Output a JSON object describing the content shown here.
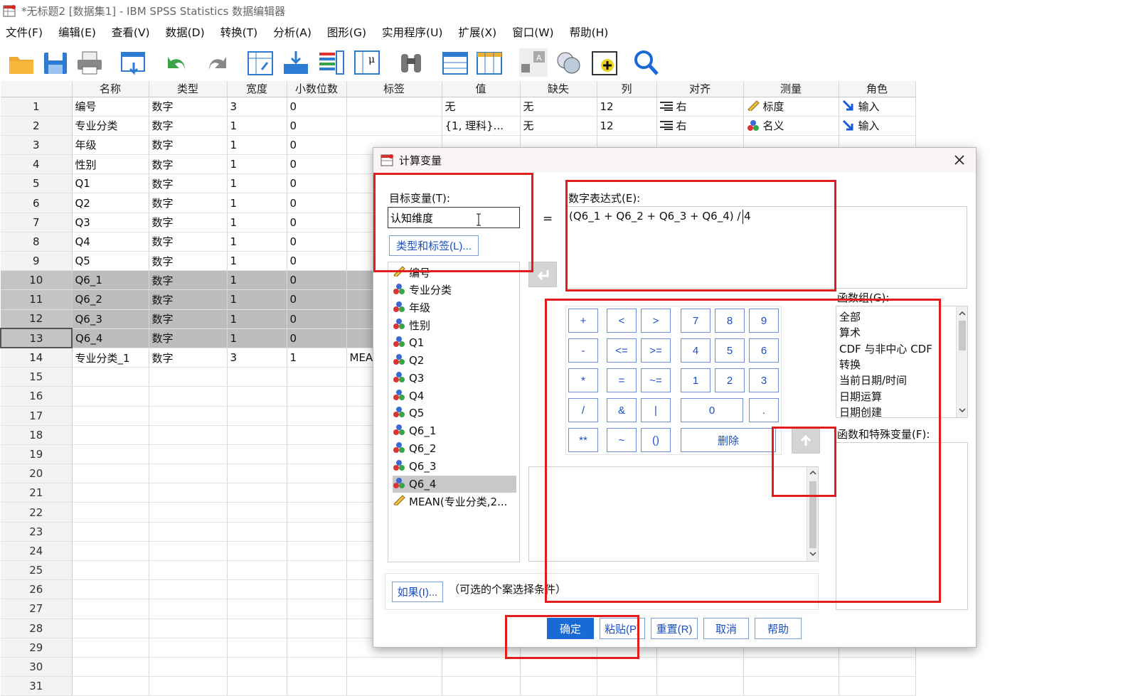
{
  "window": {
    "title": "*无标题2 [数据集1] - IBM SPSS Statistics 数据编辑器"
  },
  "menu": [
    "文件(F)",
    "编辑(E)",
    "查看(V)",
    "数据(D)",
    "转换(T)",
    "分析(A)",
    "图形(G)",
    "实用程序(U)",
    "扩展(X)",
    "窗口(W)",
    "帮助(H)"
  ],
  "grid": {
    "headers": [
      "名称",
      "类型",
      "宽度",
      "小数位数",
      "标签",
      "值",
      "缺失",
      "列",
      "对齐",
      "测量",
      "角色"
    ],
    "rows": [
      {
        "n": "1",
        "name": "编号",
        "type": "数字",
        "width": "3",
        "dec": "0",
        "label": "",
        "values": "无",
        "missing": "无",
        "cols": "12",
        "align": "右",
        "measure": "标度",
        "role": "输入"
      },
      {
        "n": "2",
        "name": "专业分类",
        "type": "数字",
        "width": "1",
        "dec": "0",
        "label": "",
        "values": "{1, 理科}...",
        "missing": "无",
        "cols": "12",
        "align": "右",
        "measure": "名义",
        "role": "输入"
      },
      {
        "n": "3",
        "name": "年级",
        "type": "数字",
        "width": "1",
        "dec": "0",
        "label": "",
        "values": "",
        "missing": "",
        "cols": "",
        "align": "",
        "measure": "",
        "role": ""
      },
      {
        "n": "4",
        "name": "性别",
        "type": "数字",
        "width": "1",
        "dec": "0"
      },
      {
        "n": "5",
        "name": "Q1",
        "type": "数字",
        "width": "1",
        "dec": "0"
      },
      {
        "n": "6",
        "name": "Q2",
        "type": "数字",
        "width": "1",
        "dec": "0"
      },
      {
        "n": "7",
        "name": "Q3",
        "type": "数字",
        "width": "1",
        "dec": "0"
      },
      {
        "n": "8",
        "name": "Q4",
        "type": "数字",
        "width": "1",
        "dec": "0"
      },
      {
        "n": "9",
        "name": "Q5",
        "type": "数字",
        "width": "1",
        "dec": "0"
      },
      {
        "n": "10",
        "name": "Q6_1",
        "type": "数字",
        "width": "1",
        "dec": "0"
      },
      {
        "n": "11",
        "name": "Q6_2",
        "type": "数字",
        "width": "1",
        "dec": "0"
      },
      {
        "n": "12",
        "name": "Q6_3",
        "type": "数字",
        "width": "1",
        "dec": "0"
      },
      {
        "n": "13",
        "name": "Q6_4",
        "type": "数字",
        "width": "1",
        "dec": "0"
      },
      {
        "n": "14",
        "name": "专业分类_1",
        "type": "数字",
        "width": "3",
        "dec": "1",
        "label": "MEA"
      }
    ],
    "empty_rows": [
      "15",
      "16",
      "17",
      "18",
      "19",
      "20",
      "21",
      "22",
      "23",
      "24",
      "25",
      "26",
      "27",
      "28",
      "29",
      "30",
      "31"
    ]
  },
  "dialog": {
    "title": "计算变量",
    "target_label": "目标变量(T):",
    "target_value": "认知维度",
    "type_label_button": "类型和标签(L)...",
    "equals": "=",
    "expr_label": "数字表达式(E):",
    "expr_value": "(Q6_1 + Q6_2 + Q6_3 + Q6_4) / 4",
    "variables": [
      "编号",
      "专业分类",
      "年级",
      "性别",
      "Q1",
      "Q2",
      "Q3",
      "Q4",
      "Q5",
      "Q6_1",
      "Q6_2",
      "Q6_3",
      "Q6_4",
      "MEAN(专业分类,2..."
    ],
    "keypad": {
      "r1": [
        "+",
        "<",
        ">",
        "7",
        "8",
        "9"
      ],
      "r2": [
        "-",
        "<=",
        ">=",
        "4",
        "5",
        "6"
      ],
      "r3": [
        "*",
        "=",
        "~=",
        "1",
        "2",
        "3"
      ],
      "r4": [
        "/",
        "&",
        "|",
        "0",
        "."
      ],
      "r5": [
        "**",
        "~",
        "()",
        "删除"
      ]
    },
    "func_group_label": "函数组(G):",
    "func_groups": [
      "全部",
      "算术",
      "CDF 与非中心 CDF",
      "转换",
      "当前日期/时间",
      "日期运算",
      "日期创建"
    ],
    "func_special_label": "函数和特殊变量(F):",
    "if_button": "如果(I)...",
    "if_hint": "（可选的个案选择条件）",
    "buttons": {
      "ok": "确定",
      "paste": "粘贴(P)",
      "reset": "重置(R)",
      "cancel": "取消",
      "help": "帮助"
    }
  }
}
